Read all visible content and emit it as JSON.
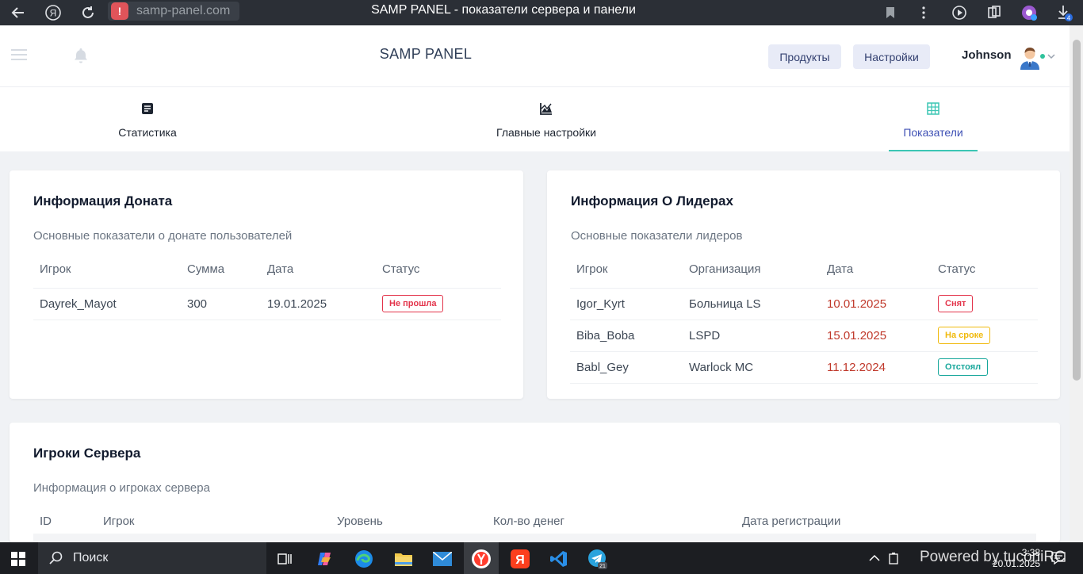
{
  "browser": {
    "url": "samp-panel.com",
    "tab_title": "SAMP PANEL - показатели сервера и панели",
    "download_badge": "4"
  },
  "header": {
    "brand": "SAMP PANEL",
    "products_label": "Продукты",
    "settings_label": "Настройки",
    "username": "Johnson"
  },
  "nav": {
    "tabs": [
      {
        "label": "Статистика",
        "icon": "document-icon",
        "active": false
      },
      {
        "label": "Главные настройки",
        "icon": "chart-icon",
        "active": false
      },
      {
        "label": "Показатели",
        "icon": "grid-icon",
        "active": true
      }
    ]
  },
  "donate": {
    "title": "Информация Доната",
    "subtitle": "Основные показатели о донате пользователей",
    "columns": [
      "Игрок",
      "Сумма",
      "Дата",
      "Статус"
    ],
    "rows": [
      {
        "player": "Dayrek_Mayot",
        "sum": "300",
        "date": "19.01.2025",
        "status": "Не прошла"
      }
    ]
  },
  "leaders": {
    "title": "Информация О Лидерах",
    "subtitle": "Основные показатели лидеров",
    "columns": [
      "Игрок",
      "Организация",
      "Дата",
      "Статус"
    ],
    "rows": [
      {
        "player": "Igor_Kyrt",
        "org": "Больница LS",
        "date": "10.01.2025",
        "status": "Снят"
      },
      {
        "player": "Biba_Boba",
        "org": "LSPD",
        "date": "15.01.2025",
        "status": "На сроке"
      },
      {
        "player": "Babl_Gey",
        "org": "Warlock MC",
        "date": "11.12.2024",
        "status": "Отстоял"
      }
    ]
  },
  "players": {
    "title": "Игроки Сервера",
    "subtitle": "Информация о игроках сервера",
    "columns": [
      "ID",
      "Игрок",
      "Уровень",
      "Кол-во денег",
      "Дата регистрации"
    ]
  },
  "taskbar": {
    "search_label": "Поиск",
    "time": "3:38",
    "date": "20.01.2025",
    "telegram_badge": "21"
  },
  "watermark": "Powered by tuconiRC",
  "colors": {
    "accent": "#3f51b5",
    "tab_underline": "#3cc6b4",
    "status_red": "#e3344b",
    "status_yellow": "#f0b90b",
    "status_teal": "#17a79b",
    "date_red": "#c0392b"
  }
}
